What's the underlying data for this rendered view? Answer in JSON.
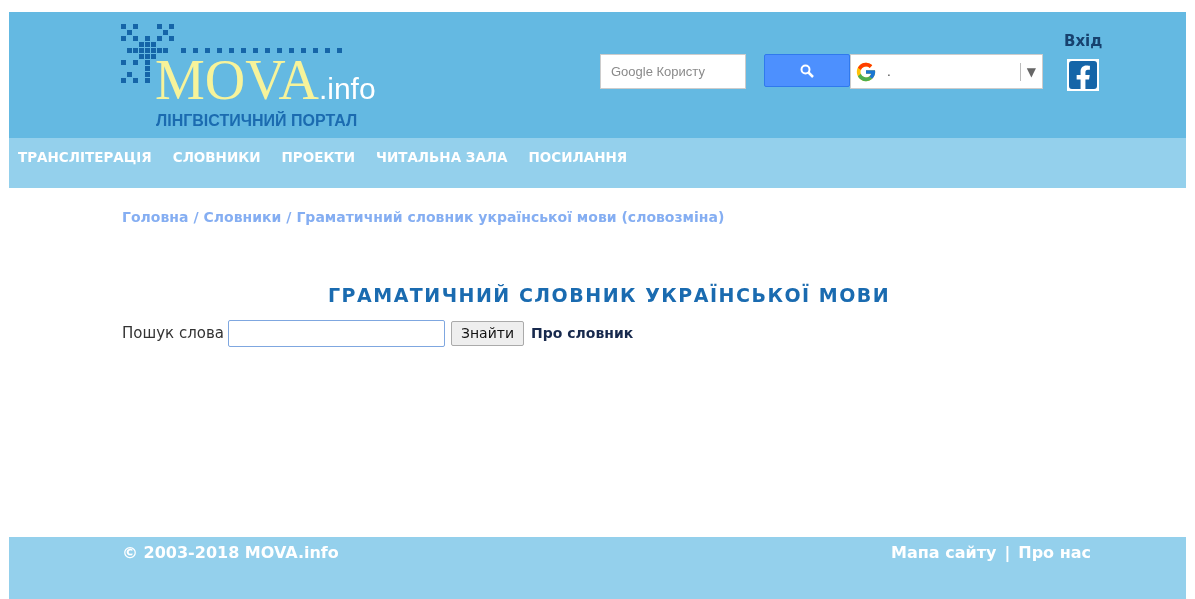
{
  "header": {
    "logo": {
      "name": "MOVA",
      "suffix": ".info",
      "tagline": "ЛІНГВІСТИЧНИЙ ПОРТАЛ"
    },
    "site_search": {
      "placeholder": "Google Користу"
    },
    "translate": {
      "value": ".",
      "arrow": "▼"
    },
    "login": "Вхід"
  },
  "nav": [
    {
      "label": "ТРАНСЛІТЕРАЦІЯ"
    },
    {
      "label": "СЛОВНИКИ"
    },
    {
      "label": "ПРОЕКТИ"
    },
    {
      "label": "ЧИТАЛЬНА ЗАЛА"
    },
    {
      "label": "ПОСИЛАННЯ"
    }
  ],
  "breadcrumb": {
    "separator": "/",
    "items": [
      {
        "label": "Головна"
      },
      {
        "label": "Словники"
      },
      {
        "label": "Граматичний словник української мови (словозміна)"
      }
    ]
  },
  "title": "ГРАМАТИЧНИЙ СЛОВНИК УКРАЇНСЬКОЇ МОВИ",
  "search": {
    "label": "Пошук слова",
    "button": "Знайти",
    "about": "Про словник"
  },
  "footer": {
    "copyright": "© 2003-2018 MOVA.info",
    "separator": "|",
    "links": [
      {
        "label": "Мапа сайту"
      },
      {
        "label": "Про нас"
      }
    ]
  }
}
